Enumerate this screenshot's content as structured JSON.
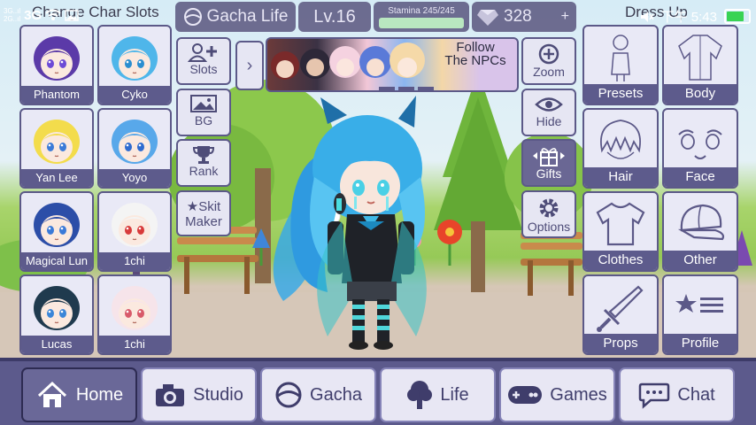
{
  "statusbar": {
    "network_top": "3G..ıl",
    "network_bottom": "2G..ıl",
    "network_type": "3G",
    "time": "下午 5:43",
    "battery_level": 0.95
  },
  "hud": {
    "game_title": "Gacha Life",
    "level": "Lv.16",
    "stamina_label": "Stamina 245/245",
    "stamina_fraction": 1.0,
    "gems": "328",
    "gems_plus": "+"
  },
  "left_panel_title": "Change Char Slots",
  "right_panel_title": "Dress Up",
  "slots": [
    {
      "name": "Phantom",
      "hair": "#5b3aa8",
      "eyes": "#6c4ad6"
    },
    {
      "name": "Cyko",
      "hair": "#4fb6ea",
      "eyes": "#2a8ed0"
    },
    {
      "name": "Yan Lee",
      "hair": "#f3dc4c",
      "eyes": "#3b7bd8"
    },
    {
      "name": "Yoyo",
      "hair": "#58a8ea",
      "eyes": "#2e6bd0"
    },
    {
      "name": "Magical Lun",
      "hair": "#2c4ea8",
      "eyes": "#3a7ad8"
    },
    {
      "name": "1chi",
      "hair": "#f4f4f4",
      "eyes": "#d83a3a"
    },
    {
      "name": "Lucas",
      "hair": "#1f3a4e",
      "eyes": "#3b86d8"
    },
    {
      "name": "1chi",
      "hair": "#f6e4ea",
      "eyes": "#d85a6a"
    }
  ],
  "tools_left": [
    {
      "label": "Slots",
      "icon": "add-user-icon"
    },
    {
      "label": "BG",
      "icon": "image-icon"
    },
    {
      "label": "Rank",
      "icon": "trophy-icon"
    },
    {
      "label": "★Skit Maker",
      "icon": ""
    }
  ],
  "npc_banner": {
    "label": "Follow The NPCs",
    "arrow": "›"
  },
  "tools_right": [
    {
      "label": "Zoom",
      "icon": "zoom-icon"
    },
    {
      "label": "Hide",
      "icon": "eye-icon"
    },
    {
      "label": "Gifts",
      "icon": "gift-icon"
    },
    {
      "label": "Options",
      "icon": "gear-icon"
    }
  ],
  "categories": [
    {
      "label": "Presets",
      "icon": "mannequin-icon"
    },
    {
      "label": "Body",
      "icon": "body-icon"
    },
    {
      "label": "Hair",
      "icon": "hair-icon"
    },
    {
      "label": "Face",
      "icon": "face-icon"
    },
    {
      "label": "Clothes",
      "icon": "shirt-icon"
    },
    {
      "label": "Other",
      "icon": "cap-icon"
    },
    {
      "label": "Props",
      "icon": "sword-icon"
    },
    {
      "label": "Profile",
      "icon": "profile-icon"
    }
  ],
  "bottom_nav": [
    {
      "label": "Home",
      "icon": "home-icon",
      "active": true
    },
    {
      "label": "Studio",
      "icon": "camera-icon",
      "active": false
    },
    {
      "label": "Gacha",
      "icon": "gacha-icon",
      "active": false
    },
    {
      "label": "Life",
      "icon": "tree-icon",
      "active": false
    },
    {
      "label": "Games",
      "icon": "gamepad-icon",
      "active": false
    },
    {
      "label": "Chat",
      "icon": "chat-icon",
      "active": false
    }
  ],
  "colors": {
    "panel": "#5c5988",
    "tile": "#e9e9f6",
    "label_bar": "#5d5b8c",
    "nav_active": "#6a6898"
  }
}
